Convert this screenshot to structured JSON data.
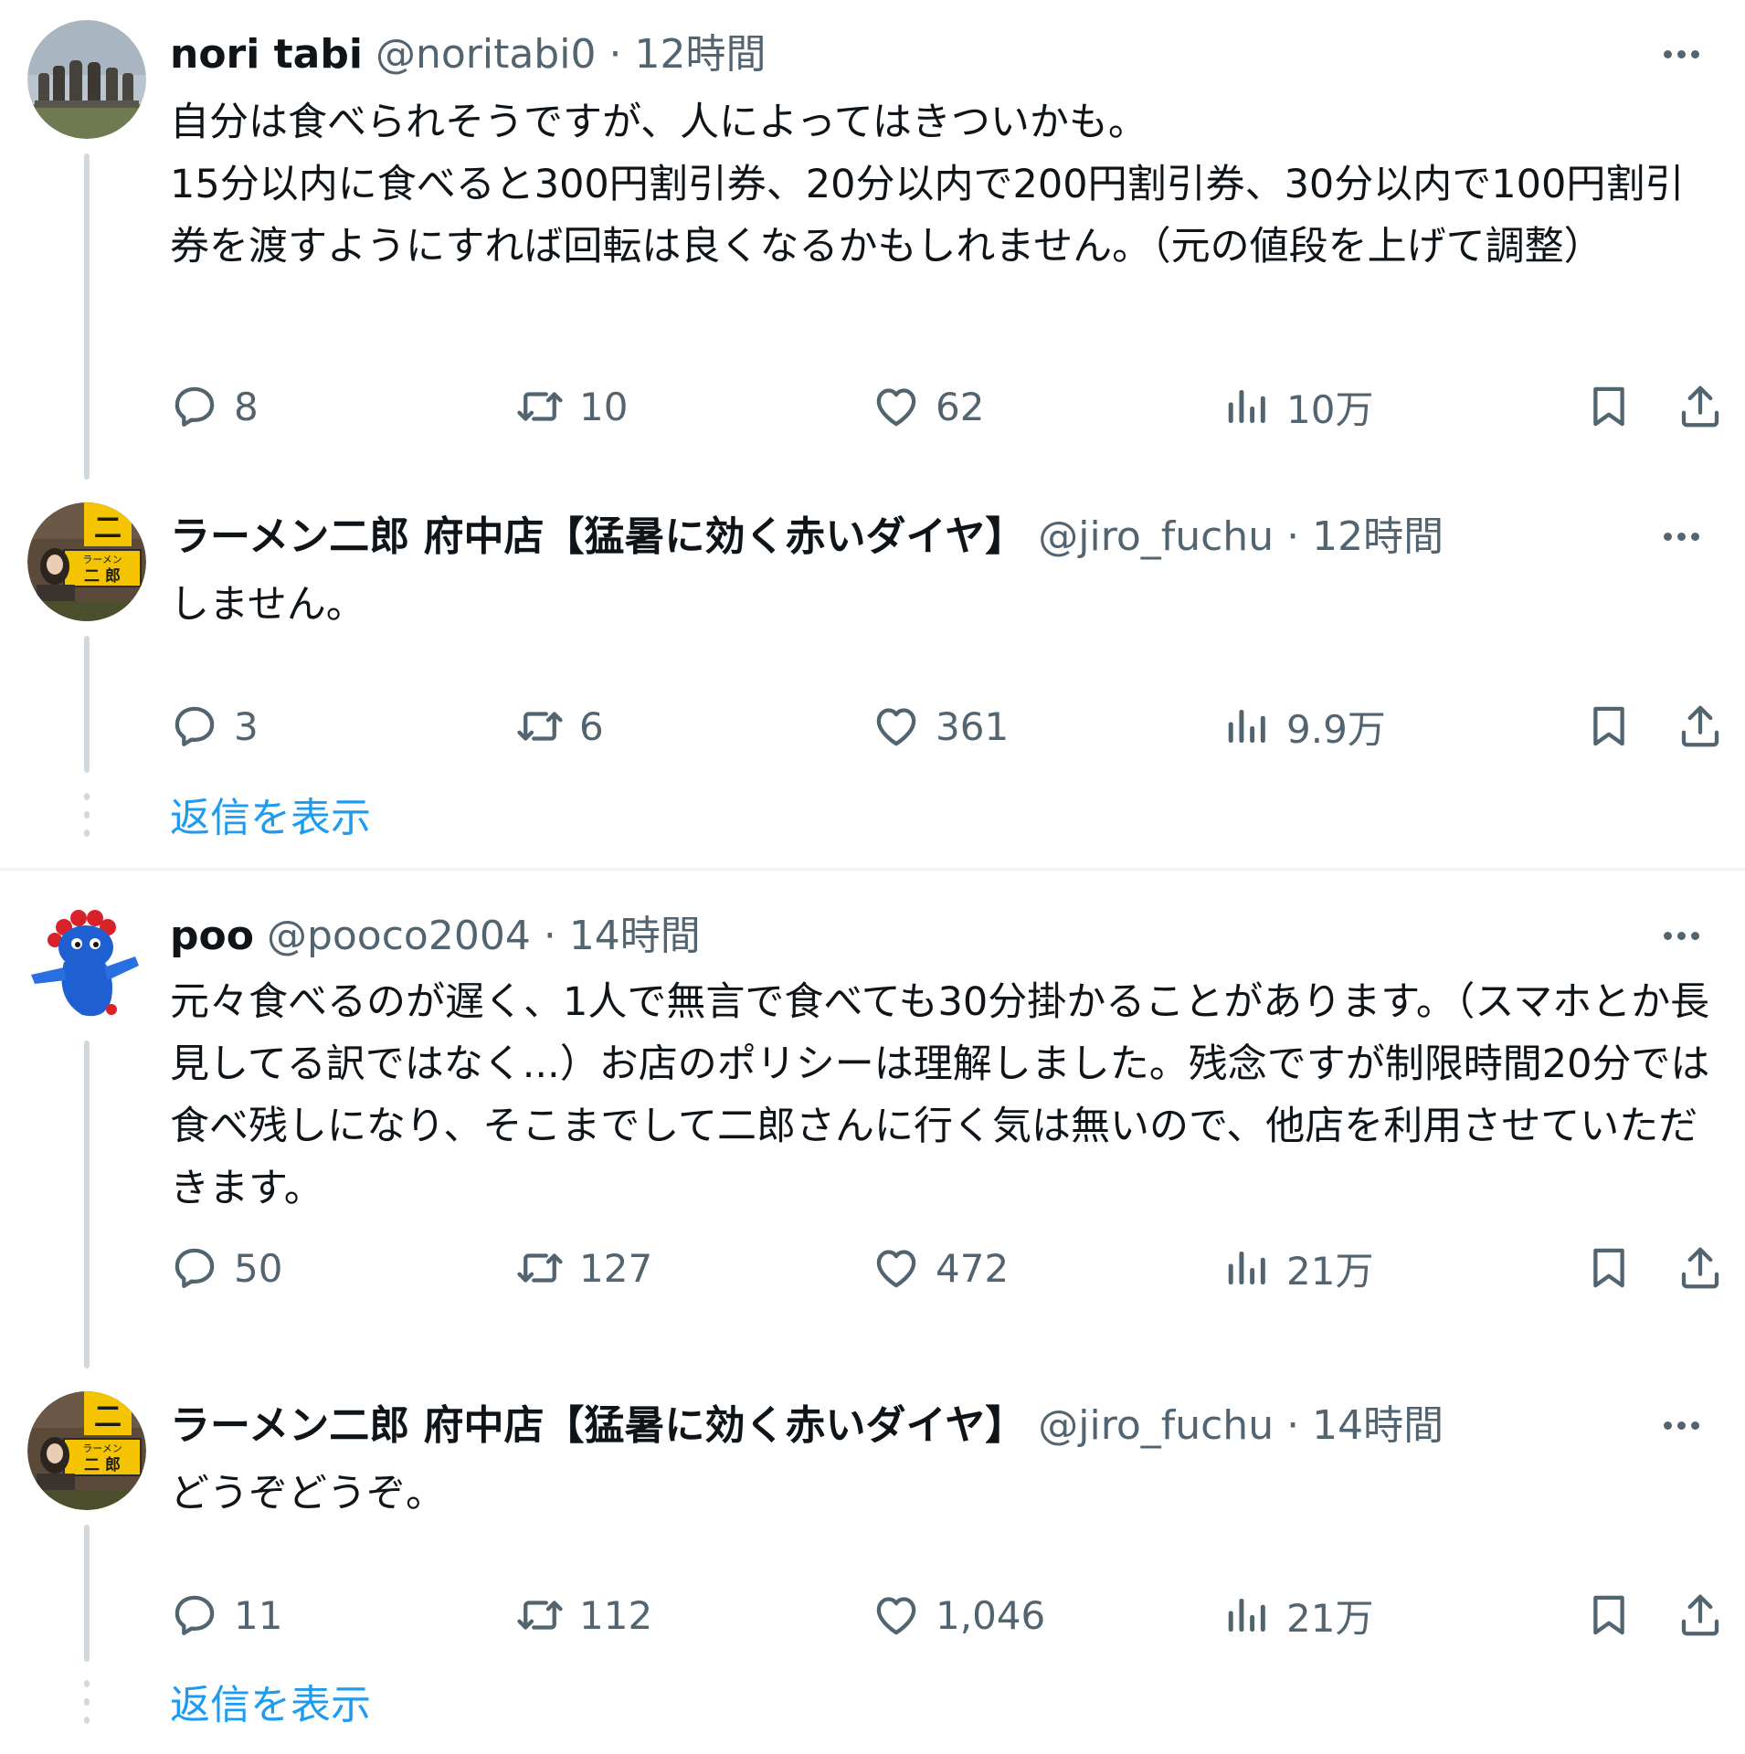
{
  "threads": [
    {
      "tweets": [
        {
          "author": "nori tabi",
          "handle": "@noritabi0",
          "separator": "·",
          "time": "12時間",
          "text": "自分は食べられそうですが、人によってはきついかも。\n15分以内に食べると300円割引券、20分以内で200円割引券、30分以内で100円割引券を渡すようにすれば回転は良くなるかもしれません。（元の値段を上げて調整）",
          "avatar": "moai-statues-avatar",
          "stats": {
            "replies": "8",
            "retweets": "10",
            "likes": "62",
            "views": "10万"
          }
        },
        {
          "author": "ラーメン二郎 府中店【猛暑に効く赤いダイヤ】",
          "handle": "@jiro_fuchu",
          "separator": "·",
          "time": "12時間",
          "text": "しません。",
          "avatar": "ramen-jiro-shop-avatar",
          "stats": {
            "replies": "3",
            "retweets": "6",
            "likes": "361",
            "views": "9.9万"
          }
        }
      ],
      "show_replies": "返信を表示"
    },
    {
      "tweets": [
        {
          "author": "poo",
          "handle": "@pooco2004",
          "separator": "·",
          "time": "14時間",
          "text": "元々食べるのが遅く、1人で無言で食べても30分掛かることがあります。（スマホとか長見してる訳ではなく...）お店のポリシーは理解しました。残念ですが制限時間20分では食べ残しになり、そこまでして二郎さんに行く気は無いので、他店を利用させていただきます。",
          "avatar": "blue-mascot-avatar",
          "stats": {
            "replies": "50",
            "retweets": "127",
            "likes": "472",
            "views": "21万"
          }
        },
        {
          "author": "ラーメン二郎 府中店【猛暑に効く赤いダイヤ】",
          "handle": "@jiro_fuchu",
          "separator": "·",
          "time": "14時間",
          "text": "どうぞどうぞ。",
          "avatar": "ramen-jiro-shop-avatar",
          "stats": {
            "replies": "11",
            "retweets": "112",
            "likes": "1,046",
            "views": "21万"
          }
        }
      ],
      "show_replies": "返信を表示"
    }
  ],
  "avatar_signs": {
    "top": "ラーメン",
    "bottom": "二 郎",
    "kanji": "二"
  },
  "colors": {
    "text": "#0f1419",
    "secondary": "#536471",
    "link": "#1d9bf0",
    "border": "#eff3f4",
    "thread_line": "#cfd9de"
  }
}
